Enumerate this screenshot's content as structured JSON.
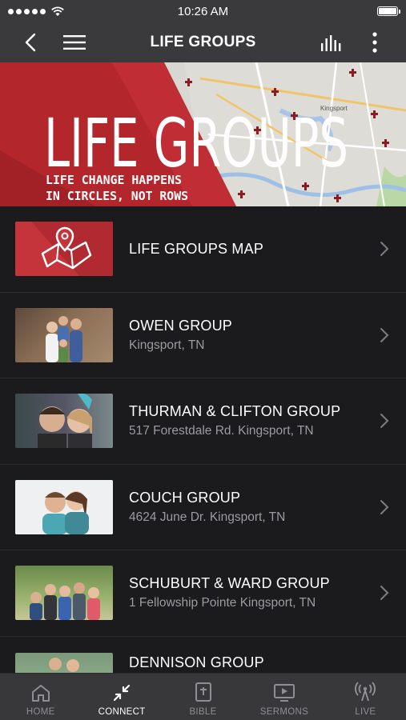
{
  "status_bar": {
    "time": "10:26 AM"
  },
  "header": {
    "title": "LIFE GROUPS"
  },
  "banner": {
    "title": "LIFE GROUPS",
    "tagline_line1": "LIFE CHANGE HAPPENS",
    "tagline_line2": "IN CIRCLES, NOT ROWS",
    "map_label": "Kingsport"
  },
  "list": {
    "items": [
      {
        "title": "LIFE GROUPS MAP",
        "subtitle": ""
      },
      {
        "title": "OWEN GROUP",
        "subtitle": "Kingsport, TN"
      },
      {
        "title": "THURMAN & CLIFTON GROUP",
        "subtitle": "517 Forestdale Rd. Kingsport, TN"
      },
      {
        "title": "COUCH GROUP",
        "subtitle": "4624 June Dr. Kingsport, TN"
      },
      {
        "title": "SCHUBURT & WARD GROUP",
        "subtitle": "1 Fellowship Pointe Kingsport, TN"
      },
      {
        "title": "DENNISON GROUP",
        "subtitle": ""
      }
    ]
  },
  "tabbar": {
    "tabs": [
      {
        "label": "HOME",
        "icon": "home-icon"
      },
      {
        "label": "CONNECT",
        "icon": "connect-icon",
        "active": true
      },
      {
        "label": "BIBLE",
        "icon": "bible-icon"
      },
      {
        "label": "SERMONS",
        "icon": "sermons-icon"
      },
      {
        "label": "LIVE",
        "icon": "live-icon"
      }
    ]
  },
  "colors": {
    "accent_red": "#b8262d",
    "nav_bg": "#3a3a3c",
    "list_bg": "#1b1b1d"
  }
}
